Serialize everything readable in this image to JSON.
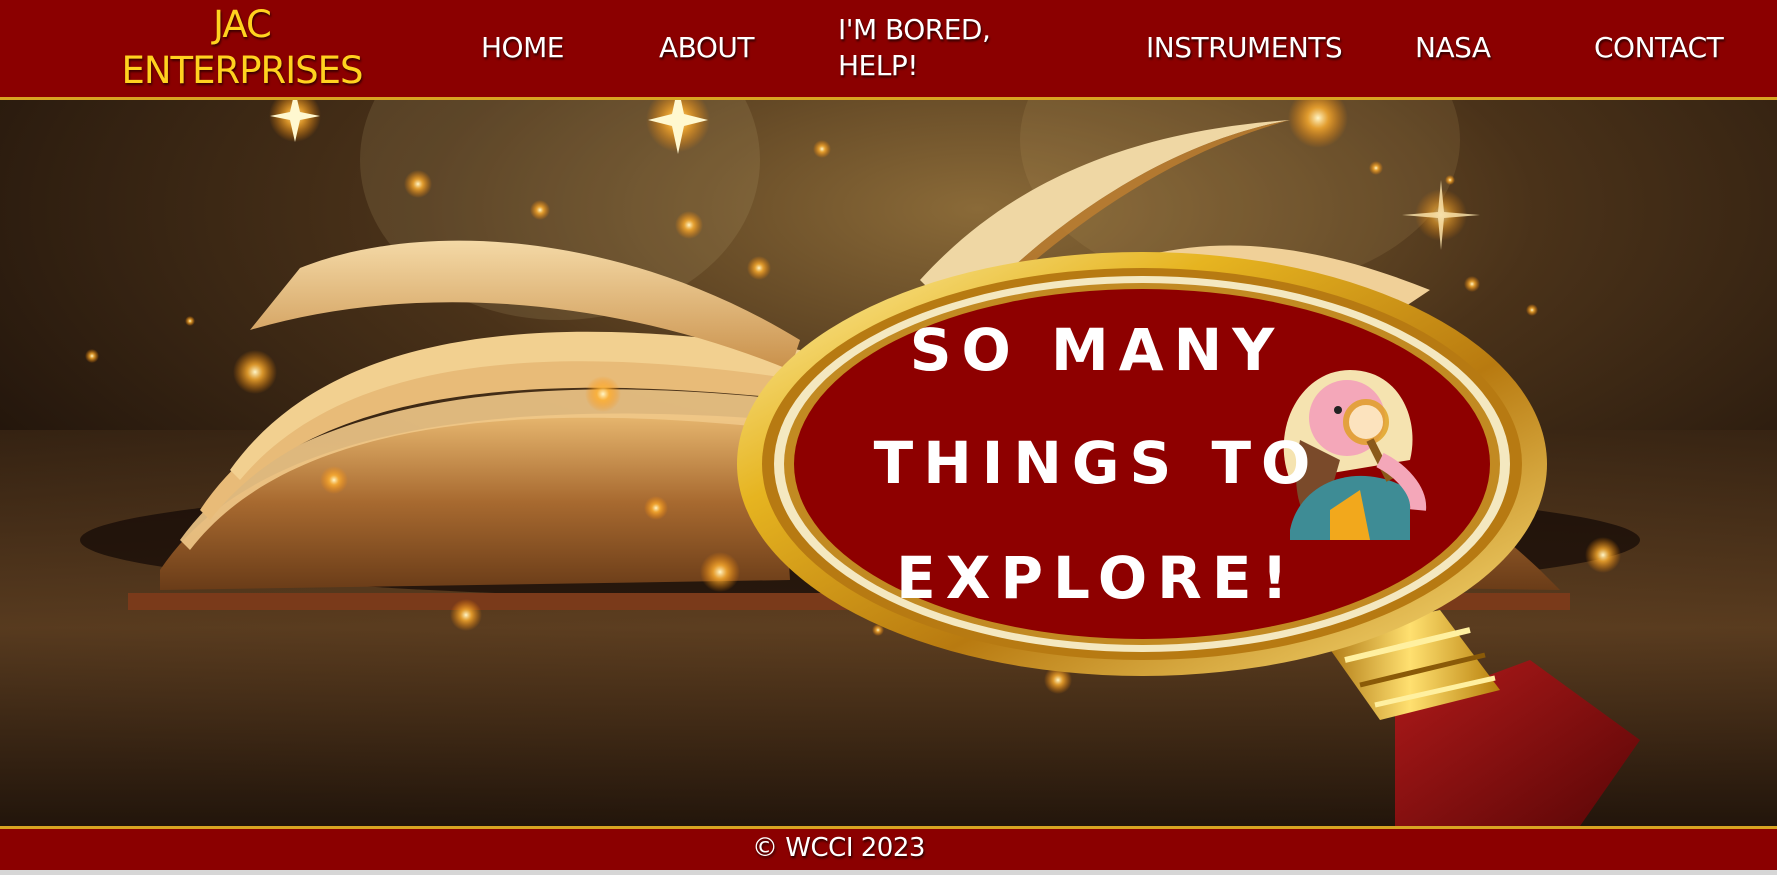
{
  "header": {
    "logo_line1": "JAC",
    "logo_line2": "ENTERPRISES",
    "nav": [
      {
        "label": "HOME"
      },
      {
        "label": "ABOUT"
      },
      {
        "label": "I'M BORED, HELP!"
      },
      {
        "label": "INSTRUMENTS"
      },
      {
        "label": "NASA"
      },
      {
        "label": "CONTACT"
      }
    ]
  },
  "hero": {
    "banner_line1": "SO MANY",
    "banner_line2": "THINGS TO",
    "banner_line3": "EXPLORE!",
    "image_description_icons": [
      "open-book-icon",
      "magnifying-glass-icon",
      "explorer-girl-icon",
      "sparkle-icon"
    ]
  },
  "footer": {
    "copyright": "© WCCI 2023"
  },
  "colors": {
    "header_bg": "#8b0000",
    "accent_gold": "#d8a422",
    "logo_yellow": "#ffd21f",
    "banner_red": "#8e0000"
  }
}
